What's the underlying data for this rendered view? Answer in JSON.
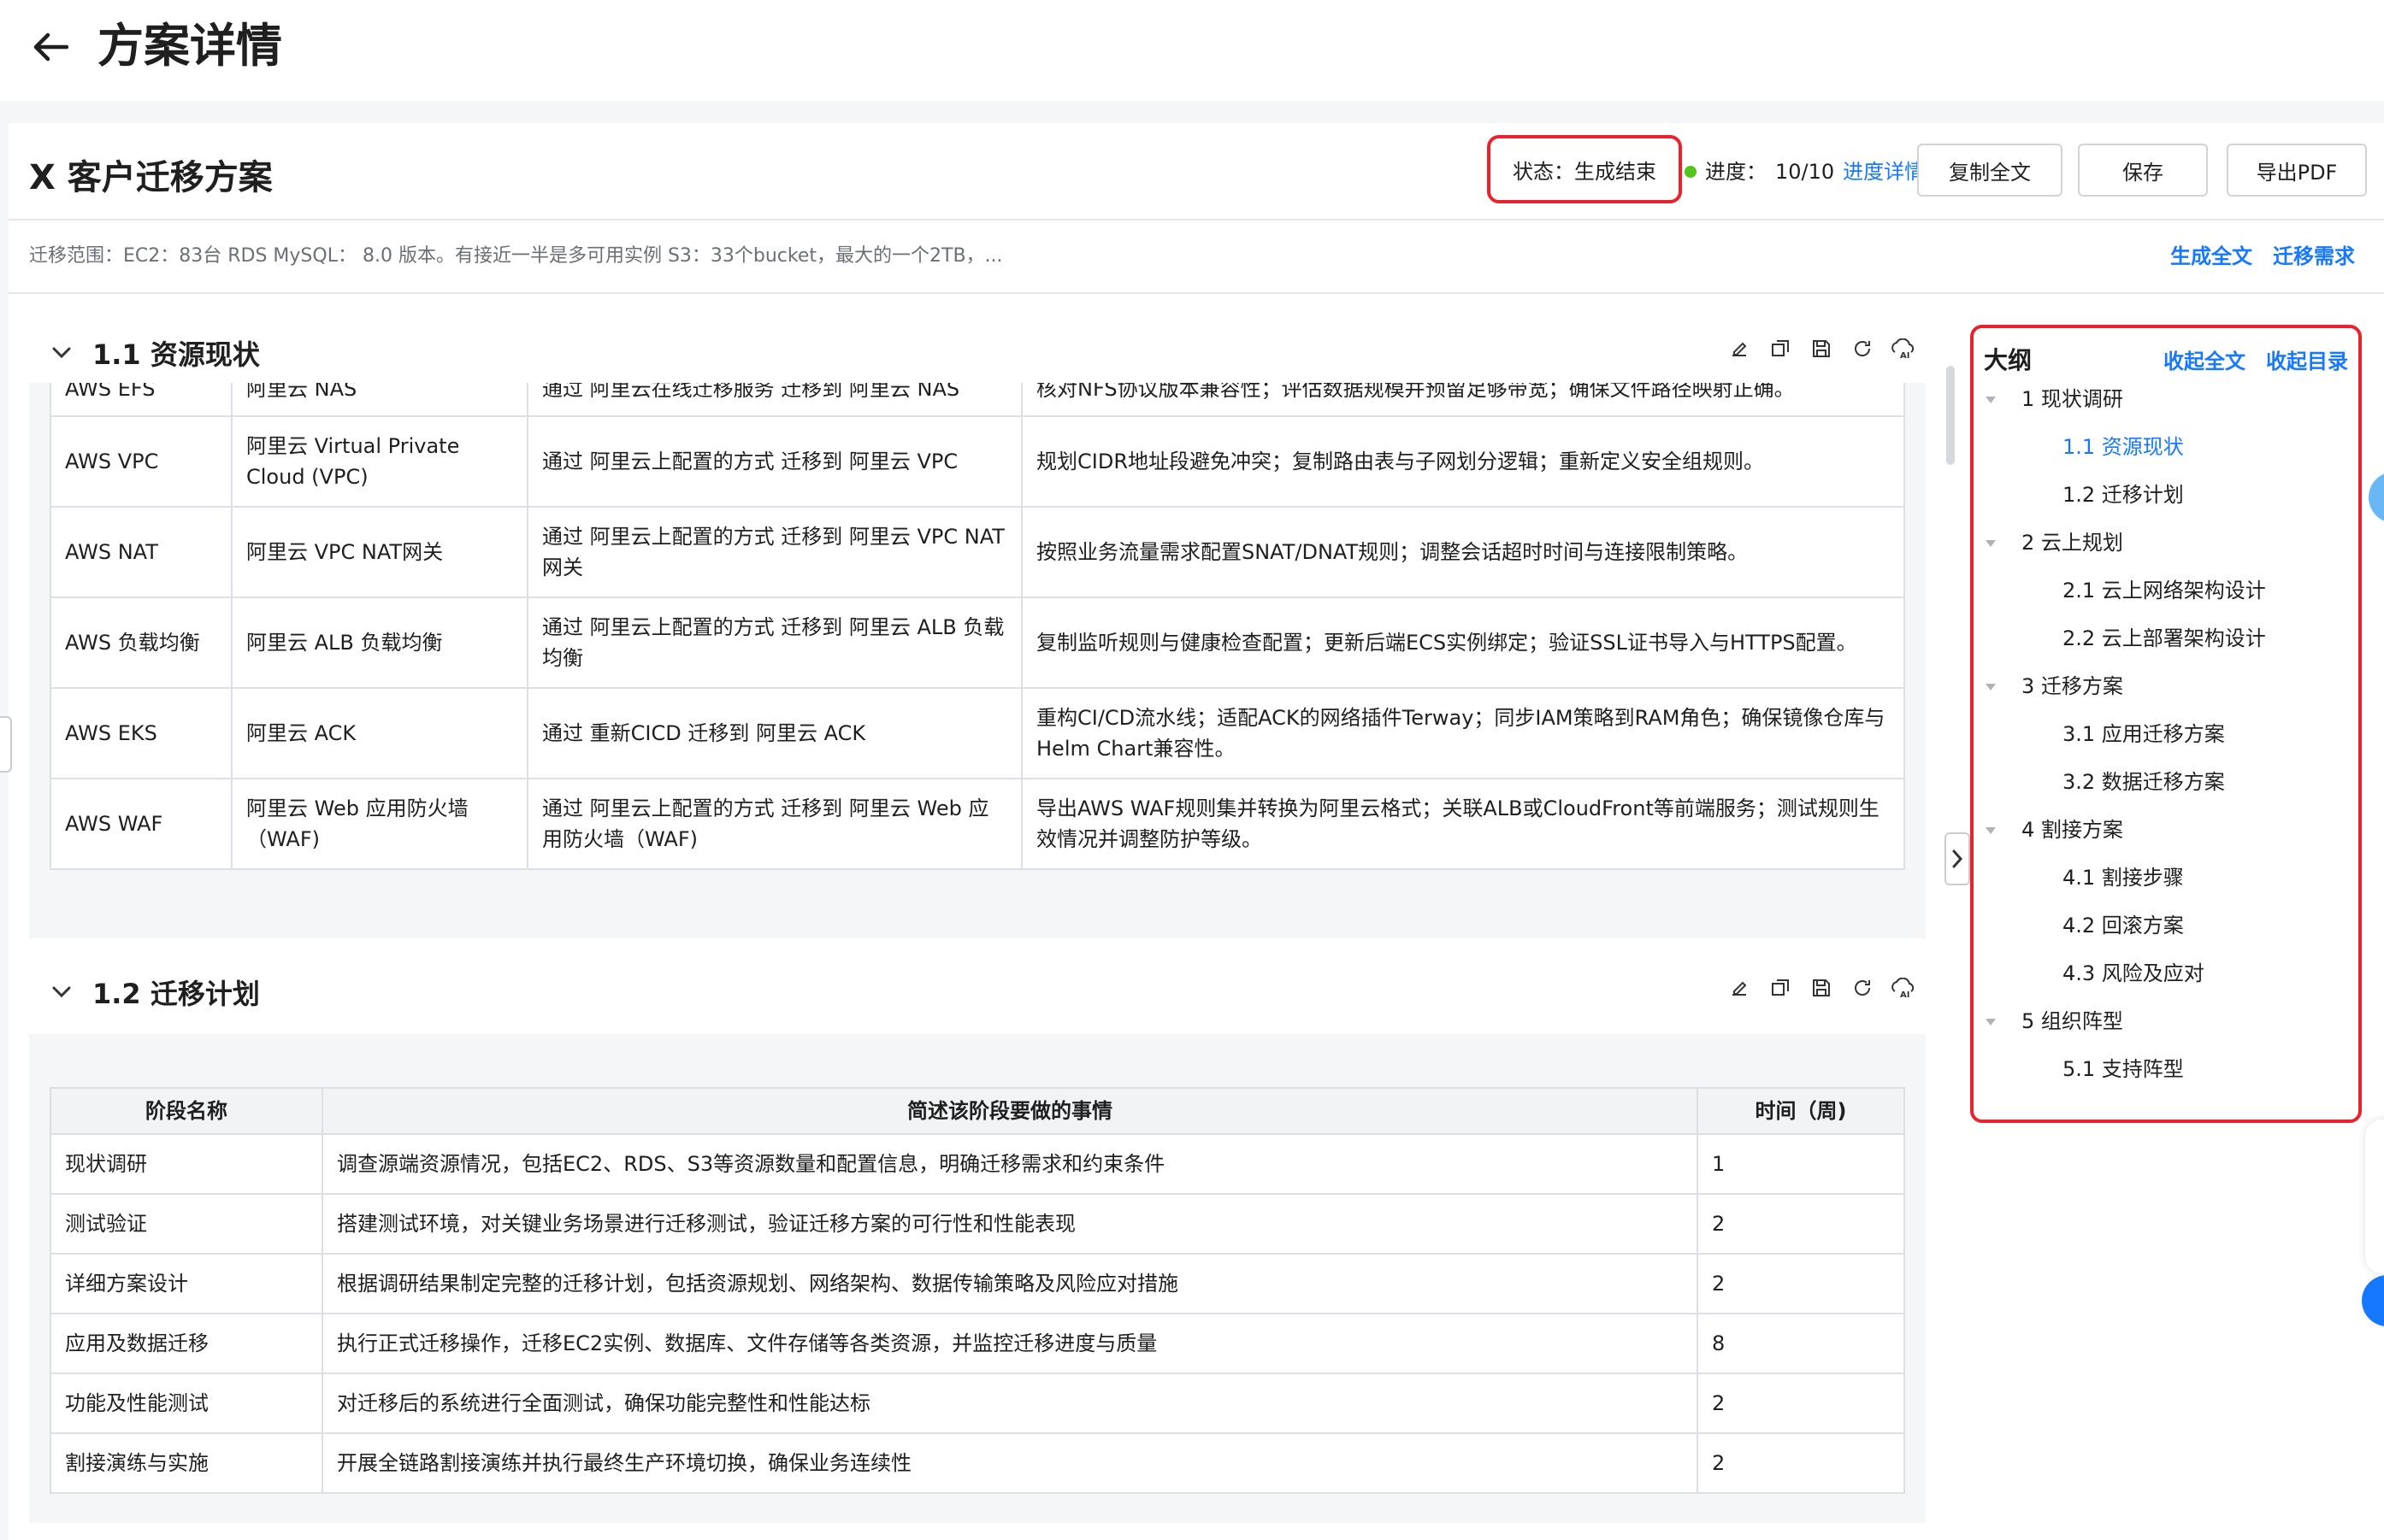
{
  "header": {
    "title": "方案详情"
  },
  "doc": {
    "title": "X 客户迁移方案",
    "status_label": "状态：",
    "status_value": "生成结束",
    "progress_label": "进度：",
    "progress_value": "10/10",
    "progress_fraction": 1.0,
    "progress_link": "进度详情",
    "buttons": {
      "copy": "复制全文",
      "save": "保存",
      "export": "导出PDF"
    },
    "scope": "迁移范围：EC2：83台 RDS MySQL： 8.0 版本。有接近一半是多可用实例 S3：33个bucket，最大的一个2TB，...",
    "scope_links": {
      "generate": "生成全文",
      "requirements": "迁移需求"
    }
  },
  "sections": [
    {
      "title": "1.1 资源现状",
      "rows": [
        [
          "AWS EFS",
          "阿里云 NAS",
          "通过 阿里云在线迁移服务 迁移到 阿里云 NAS",
          "核对NFS协议版本兼容性；评估数据规模并预留足够带宽；确保文件路径映射正确。"
        ],
        [
          "AWS VPC",
          "阿里云 Virtual Private Cloud (VPC)",
          "通过 阿里云上配置的方式 迁移到 阿里云 VPC",
          "规划CIDR地址段避免冲突；复制路由表与子网划分逻辑；重新定义安全组规则。"
        ],
        [
          "AWS NAT",
          "阿里云 VPC NAT网关",
          "通过 阿里云上配置的方式 迁移到 阿里云 VPC NAT 网关",
          "按照业务流量需求配置SNAT/DNAT规则；调整会话超时时间与连接限制策略。"
        ],
        [
          "AWS 负载均衡",
          "阿里云 ALB 负载均衡",
          "通过 阿里云上配置的方式 迁移到 阿里云 ALB 负载均衡",
          "复制监听规则与健康检查配置；更新后端ECS实例绑定；验证SSL证书导入与HTTPS配置。"
        ],
        [
          "AWS EKS",
          "阿里云 ACK",
          "通过 重新CICD 迁移到 阿里云 ACK",
          "重构CI/CD流水线；适配ACK的网络插件Terway；同步IAM策略到RAM角色；确保镜像仓库与Helm Chart兼容性。"
        ],
        [
          "AWS WAF",
          "阿里云 Web 应用防火墙（WAF)",
          "通过 阿里云上配置的方式 迁移到 阿里云 Web 应用防火墙（WAF)",
          "导出AWS WAF规则集并转换为阿里云格式；关联ALB或CloudFront等前端服务；测试规则生效情况并调整防护等级。"
        ]
      ]
    },
    {
      "title": "1.2 迁移计划",
      "headers": [
        "阶段名称",
        "简述该阶段要做的事情",
        "时间（周)"
      ],
      "rows": [
        [
          "现状调研",
          "调查源端资源情况，包括EC2、RDS、S3等资源数量和配置信息，明确迁移需求和约束条件",
          "1"
        ],
        [
          "测试验证",
          "搭建测试环境，对关键业务场景进行迁移测试，验证迁移方案的可行性和性能表现",
          "2"
        ],
        [
          "详细方案设计",
          "根据调研结果制定完整的迁移计划，包括资源规划、网络架构、数据传输策略及风险应对措施",
          "2"
        ],
        [
          "应用及数据迁移",
          "执行正式迁移操作，迁移EC2实例、数据库、文件存储等各类资源，并监控迁移进度与质量",
          "8"
        ],
        [
          "功能及性能测试",
          "对迁移后的系统进行全面测试，确保功能完整性和性能达标",
          "2"
        ],
        [
          "割接演练与实施",
          "开展全链路割接演练并执行最终生产环境切换，确保业务连续性",
          "2"
        ]
      ]
    }
  ],
  "outline": {
    "title": "大纲",
    "collapse_all": "收起全文",
    "collapse_toc": "收起目录",
    "items": [
      {
        "label": "1 现状调研",
        "level": 1
      },
      {
        "label": "1.1 资源现状",
        "level": 2,
        "active": true
      },
      {
        "label": "1.2 迁移计划",
        "level": 2
      },
      {
        "label": "2 云上规划",
        "level": 1
      },
      {
        "label": "2.1 云上网络架构设计",
        "level": 2
      },
      {
        "label": "2.2 云上部署架构设计",
        "level": 2
      },
      {
        "label": "3 迁移方案",
        "level": 1
      },
      {
        "label": "3.1 应用迁移方案",
        "level": 2
      },
      {
        "label": "3.2 数据迁移方案",
        "level": 2
      },
      {
        "label": "4 割接方案",
        "level": 1
      },
      {
        "label": "4.1 割接步骤",
        "level": 2
      },
      {
        "label": "4.2 回滚方案",
        "level": 2
      },
      {
        "label": "4.3 风险及应对",
        "level": 2
      },
      {
        "label": "5 组织阵型",
        "level": 1
      },
      {
        "label": "5.1 支持阵型",
        "level": 2
      }
    ]
  },
  "colors": {
    "accent": "#1677ff",
    "highlight_border": "#e8232b",
    "status_dot": "#52c41a"
  },
  "icons": [
    "back-arrow-icon",
    "chevron-down-icon",
    "edit-icon",
    "copy-icon",
    "save-icon",
    "refresh-icon",
    "ai-icon",
    "chevron-right-icon",
    "caret-down-icon"
  ]
}
